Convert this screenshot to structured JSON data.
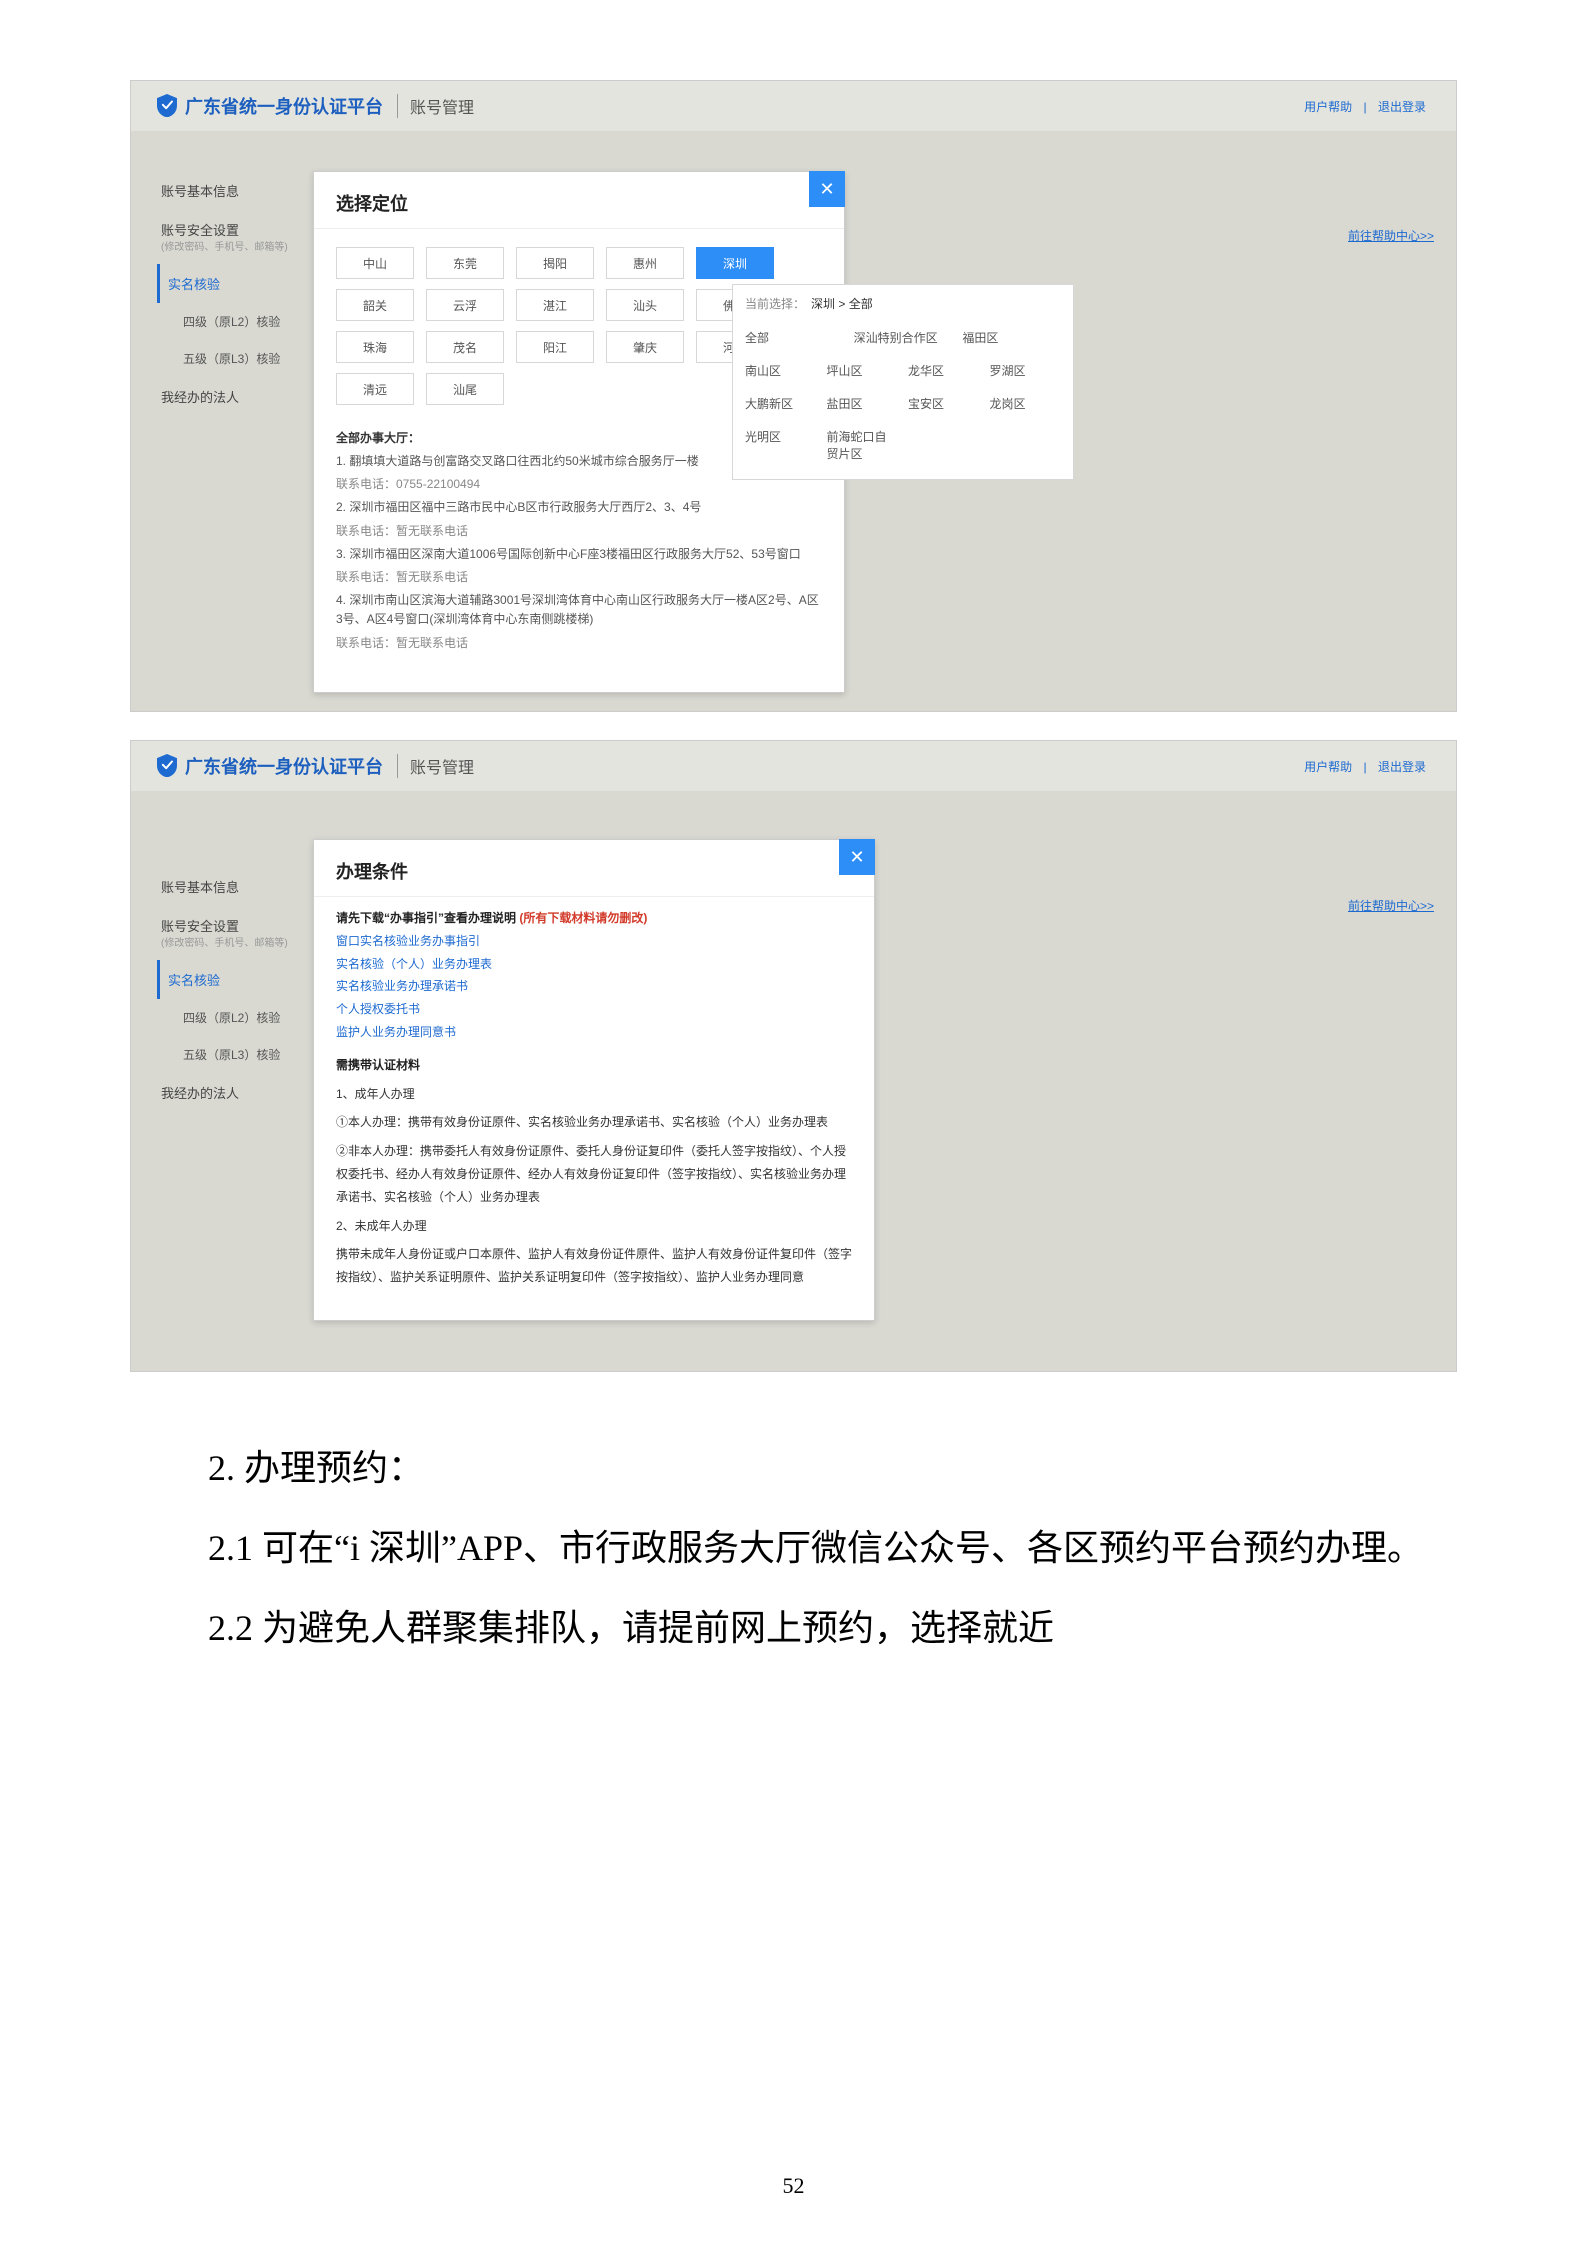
{
  "app": {
    "title": "广东省统一身份认证平台",
    "subtitle": "账号管理",
    "links": {
      "help": "用户帮助",
      "logout": "退出登录",
      "sep": "|"
    }
  },
  "sidebar": {
    "items": [
      {
        "label": "账号基本信息"
      },
      {
        "label": "账号安全设置",
        "sub": "(修改密码、手机号、邮箱等)"
      },
      {
        "label": "实名核验",
        "active": true
      },
      {
        "label": "四级（原L2）核验",
        "indent": true
      },
      {
        "label": "五级（原L3）核验",
        "indent": true
      },
      {
        "label": "我经办的法人"
      }
    ]
  },
  "help_center": "前往帮助中心>>",
  "screenshot1": {
    "modal_title": "选择定位",
    "cities_row1": [
      "中山",
      "东莞",
      "揭阳",
      "惠州",
      "深圳",
      "韶关"
    ],
    "cities_row2": [
      "云浮",
      "湛江",
      "汕头",
      "佛山"
    ],
    "cities_row3": [
      "珠海",
      "茂名",
      "阳江",
      "肇庆"
    ],
    "cities_row4": [
      "河源",
      "清远",
      "汕尾"
    ],
    "selected_city": "深圳",
    "crumb_label": "当前选择：",
    "crumb_path": "深圳 > 全部",
    "districts_row_top": [
      "全部",
      "深汕特别合作区",
      "福田区"
    ],
    "districts": [
      "南山区",
      "坪山区",
      "龙华区",
      "罗湖区",
      "大鹏新区",
      "盐田区",
      "宝安区",
      "龙岗区",
      "光明区",
      "前海蛇口自贸片区"
    ],
    "hall_title": "全部办事大厅：",
    "halls": [
      {
        "text": "1. 翻填填大道路与创富路交叉路口往西北约50米城市综合服务厅一楼",
        "tel": "联系电话：0755-22100494"
      },
      {
        "text": "2. 深圳市福田区福中三路市民中心B区市行政服务大厅西厅2、3、4号",
        "tel": "联系电话：暂无联系电话"
      },
      {
        "text": "3. 深圳市福田区深南大道1006号国际创新中心F座3楼福田区行政服务大厅52、53号窗口",
        "tel": "联系电话：暂无联系电话"
      },
      {
        "text": "4. 深圳市南山区滨海大道辅路3001号深圳湾体育中心南山区行政服务大厅一楼A区2号、A区3号、A区4号窗口(深圳湾体育中心东南侧跳楼梯)",
        "tel": "联系电话：暂无联系电话"
      }
    ]
  },
  "screenshot2": {
    "peek_title": "实名核验",
    "modal_title": "办理条件",
    "lead_prefix": "请先下载“办事指引”查看办理说明",
    "lead_warn": " (所有下载材料请勿删改)",
    "links": [
      "窗口实名核验业务办事指引",
      "实名核验（个人）业务办理表",
      "实名核验业务办理承诺书",
      "个人授权委托书",
      "监护人业务办理同意书"
    ],
    "strong1": "需携带认证材料",
    "p1": "1、成年人办理",
    "p2": "①本人办理：携带有效身份证原件、实名核验业务办理承诺书、实名核验（个人）业务办理表",
    "p3": "②非本人办理：携带委托人有效身份证原件、委托人身份证复印件（委托人签字按指纹）、个人授权委托书、经办人有效身份证原件、经办人有效身份证复印件（签字按指纹）、实名核验业务办理承诺书、实名核验（个人）业务办理表",
    "p4": "2、未成年人办理",
    "p5": "携带未成年人身份证或户口本原件、监护人有效身份证件原件、监护人有效身份证件复印件（签字按指纹）、监护关系证明原件、监护关系证明复印件（签字按指纹）、监护人业务办理同意"
  },
  "doc": {
    "line1": "2. 办理预约：",
    "line2": "2.1 可在“i 深圳”APP、市行政服务大厅微信公众号、各区预约平台预约办理。",
    "line3": "2.2 为避免人群聚集排队，请提前网上预约，选择就近"
  },
  "page_number": "52"
}
